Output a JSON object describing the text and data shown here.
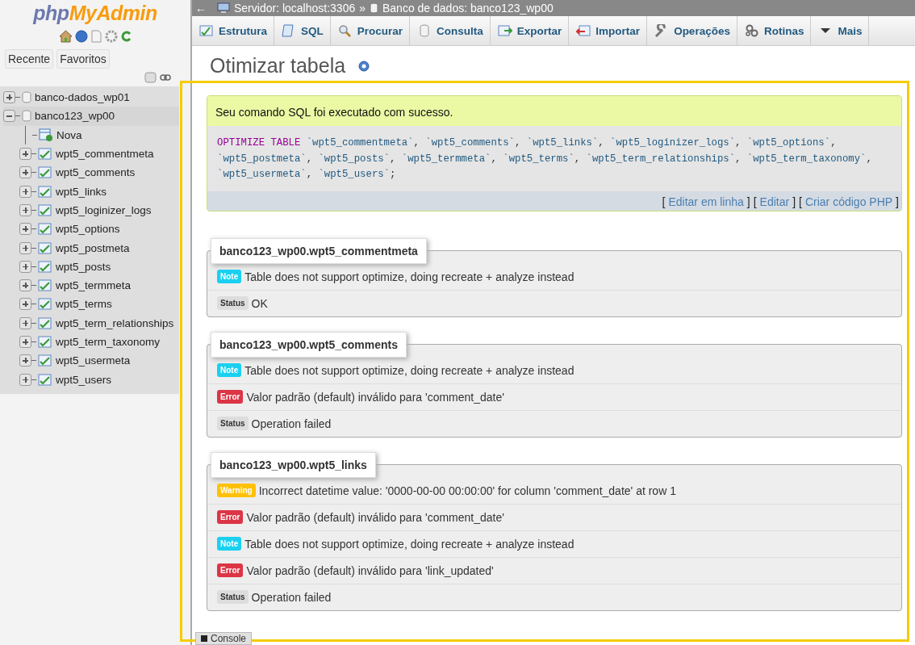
{
  "sidebar": {
    "logo": {
      "prefix": "php",
      "suffix": "MyAdmin"
    },
    "buttons": [
      "Recente",
      "Favoritos"
    ],
    "tree": [
      {
        "label": "banco-dados_wp01",
        "kind": "database",
        "expanded": false
      },
      {
        "label": "banco123_wp00",
        "kind": "database",
        "expanded": true,
        "children": [
          {
            "label": "Nova",
            "kind": "new"
          },
          {
            "label": "wpt5_commentmeta",
            "kind": "table",
            "expanded": false
          },
          {
            "label": "wpt5_comments",
            "kind": "table",
            "expanded": false
          },
          {
            "label": "wpt5_links",
            "kind": "table",
            "expanded": false
          },
          {
            "label": "wpt5_loginizer_logs",
            "kind": "table",
            "expanded": false
          },
          {
            "label": "wpt5_options",
            "kind": "table",
            "expanded": false
          },
          {
            "label": "wpt5_postmeta",
            "kind": "table",
            "expanded": false
          },
          {
            "label": "wpt5_posts",
            "kind": "table",
            "expanded": false
          },
          {
            "label": "wpt5_termmeta",
            "kind": "table",
            "expanded": false
          },
          {
            "label": "wpt5_terms",
            "kind": "table",
            "expanded": false
          },
          {
            "label": "wpt5_term_relationships",
            "kind": "table",
            "expanded": false
          },
          {
            "label": "wpt5_term_taxonomy",
            "kind": "table",
            "expanded": false
          },
          {
            "label": "wpt5_usermeta",
            "kind": "table",
            "expanded": false
          },
          {
            "label": "wpt5_users",
            "kind": "table",
            "expanded": false
          }
        ]
      }
    ]
  },
  "breadcrumb": {
    "back": "←",
    "server": "Servidor: localhost:3306",
    "separator": "»",
    "database": "Banco de dados: banco123_wp00"
  },
  "tabs": [
    "Estrutura",
    "SQL",
    "Procurar",
    "Consulta",
    "Exportar",
    "Importar",
    "Operações",
    "Rotinas",
    "Mais"
  ],
  "page_title": "Otimizar tabela",
  "success": {
    "message": "Seu comando SQL foi executado com sucesso.",
    "sql_lines": [
      [
        {
          "kind": "keyword",
          "text": "OPTIMIZE TABLE"
        },
        {
          "kind": "ident",
          "text": "`wpt5_commentmeta`"
        },
        {
          "kind": "punct",
          "text": ", "
        },
        {
          "kind": "ident",
          "text": "`wpt5_comments`"
        },
        {
          "kind": "punct",
          "text": ", "
        },
        {
          "kind": "ident",
          "text": "`wpt5_links`"
        },
        {
          "kind": "punct",
          "text": ", "
        },
        {
          "kind": "ident",
          "text": "`wpt5_loginizer_logs`"
        },
        {
          "kind": "punct",
          "text": ", "
        },
        {
          "kind": "ident",
          "text": "`wpt5_options`"
        },
        {
          "kind": "punct",
          "text": ","
        }
      ],
      [
        {
          "kind": "ident",
          "text": "`wpt5_postmeta`"
        },
        {
          "kind": "punct",
          "text": ", "
        },
        {
          "kind": "ident",
          "text": "`wpt5_posts`"
        },
        {
          "kind": "punct",
          "text": ", "
        },
        {
          "kind": "ident",
          "text": "`wpt5_termmeta`"
        },
        {
          "kind": "punct",
          "text": ", "
        },
        {
          "kind": "ident",
          "text": "`wpt5_terms`"
        },
        {
          "kind": "punct",
          "text": ", "
        },
        {
          "kind": "ident",
          "text": "`wpt5_term_relationships`"
        },
        {
          "kind": "punct",
          "text": ", "
        },
        {
          "kind": "ident",
          "text": "`wpt5_term_taxonomy`"
        },
        {
          "kind": "punct",
          "text": ","
        }
      ],
      [
        {
          "kind": "ident",
          "text": "`wpt5_usermeta`"
        },
        {
          "kind": "punct",
          "text": ", "
        },
        {
          "kind": "ident",
          "text": "`wpt5_users`"
        },
        {
          "kind": "punct",
          "text": ";"
        }
      ]
    ],
    "bracket_open": "[",
    "bracket_close": "]",
    "links": [
      "Editar em linha",
      "Editar",
      "Criar código PHP"
    ]
  },
  "results": [
    {
      "table": "banco123_wp00.wpt5_commentmeta",
      "messages": [
        {
          "kind": "note",
          "badge": "Note",
          "text": "Table does not support optimize, doing recreate + analyze instead"
        },
        {
          "kind": "status",
          "badge": "Status",
          "text": "OK"
        }
      ]
    },
    {
      "table": "banco123_wp00.wpt5_comments",
      "messages": [
        {
          "kind": "note",
          "badge": "Note",
          "text": "Table does not support optimize, doing recreate + analyze instead"
        },
        {
          "kind": "error",
          "badge": "Error",
          "text": "Valor padrão (default) inválido para 'comment_date'"
        },
        {
          "kind": "status",
          "badge": "Status",
          "text": "Operation failed"
        }
      ]
    },
    {
      "table": "banco123_wp00.wpt5_links",
      "messages": [
        {
          "kind": "warning",
          "badge": "Warning",
          "text": "Incorrect datetime value: '0000-00-00 00:00:00' for column 'comment_date' at row 1"
        },
        {
          "kind": "error",
          "badge": "Error",
          "text": "Valor padrão (default) inválido para 'comment_date'"
        },
        {
          "kind": "note",
          "badge": "Note",
          "text": "Table does not support optimize, doing recreate + analyze instead"
        },
        {
          "kind": "error",
          "badge": "Error",
          "text": "Valor padrão (default) inválido para 'link_updated'"
        },
        {
          "kind": "status",
          "badge": "Status",
          "text": "Operation failed"
        }
      ]
    }
  ],
  "console": "Console"
}
